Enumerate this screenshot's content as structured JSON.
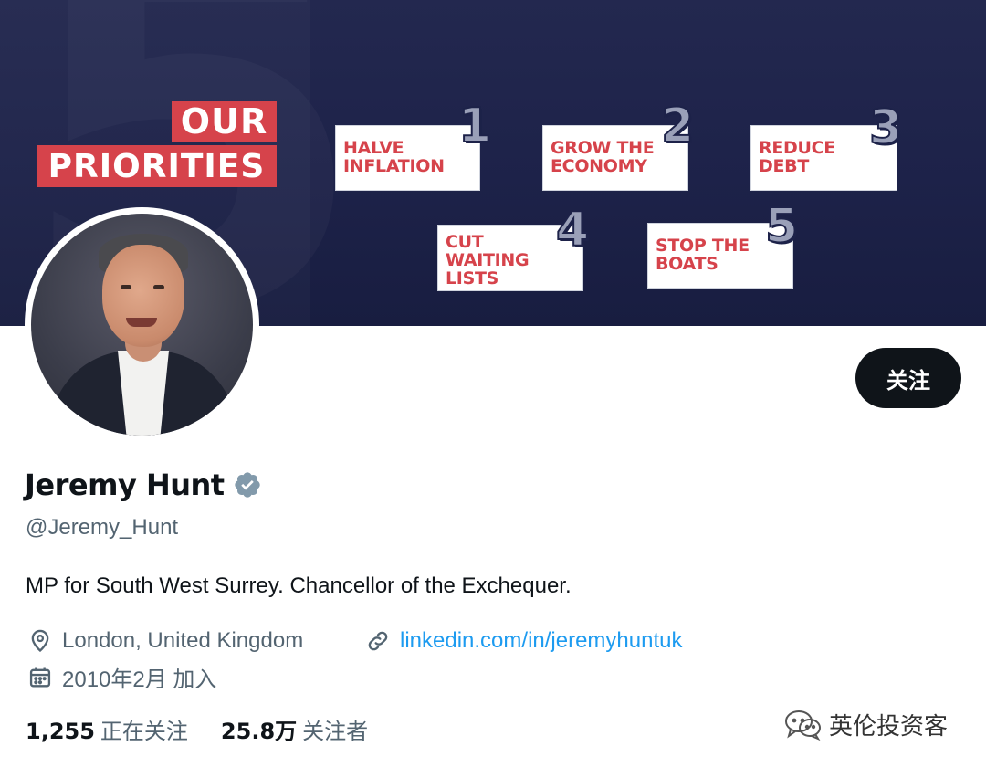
{
  "banner": {
    "title_line1": "OUR",
    "title_line2": "PRIORITIES",
    "priorities": [
      {
        "number": "1",
        "text": "HALVE\nINFLATION"
      },
      {
        "number": "2",
        "text": "GROW THE\nECONOMY"
      },
      {
        "number": "3",
        "text": "REDUCE\nDEBT"
      },
      {
        "number": "4",
        "text": "CUT\nWAITING\nLISTS"
      },
      {
        "number": "5",
        "text": "STOP THE\nBOATS"
      }
    ],
    "colors": {
      "background": "#1d2249",
      "accent": "#d6434b"
    }
  },
  "profile": {
    "display_name": "Jeremy Hunt",
    "handle": "@Jeremy_Hunt",
    "verified": true,
    "bio": "MP for South West Surrey. Chancellor of the Exchequer.",
    "location": "London, United Kingdom",
    "website": "linkedin.com/in/jeremyhuntuk",
    "joined": "2010年2月 加入",
    "follow_label": "关注",
    "following_count": "1,255",
    "following_label": "正在关注",
    "followers_count": "25.8万",
    "followers_label": "关注者"
  },
  "watermark": {
    "text": "英伦投资客"
  },
  "icons": {
    "location": "location-pin-icon",
    "link": "link-icon",
    "calendar": "calendar-icon",
    "verified": "verified-badge-icon"
  },
  "colors": {
    "link": "#1d9bf0",
    "secondary_text": "#536471",
    "button": "#0f1419"
  }
}
